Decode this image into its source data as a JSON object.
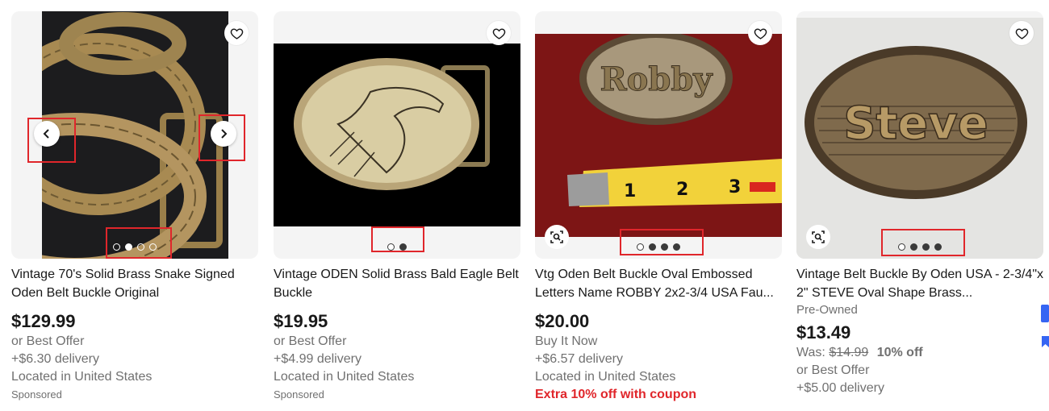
{
  "colors": {
    "accent_red": "#e0262b",
    "link_blue": "#3665f3",
    "muted_text": "#707070",
    "text": "#191919"
  },
  "icons": {
    "favorite": "heart-outline-icon",
    "prev": "chevron-left-icon",
    "next": "chevron-right-icon",
    "visual_search": "image-search-icon"
  },
  "listings": [
    {
      "title": "Vintage 70's Solid Brass Snake Signed Oden Belt Buckle Original",
      "price": "$129.99",
      "lines": [
        "or Best Offer",
        "+$6.30 delivery",
        "Located in United States"
      ],
      "footer": "Sponsored",
      "image_count": 4,
      "active_image": 2
    },
    {
      "title": "Vintage ODEN Solid Brass Bald Eagle Belt Buckle",
      "price": "$19.95",
      "lines": [
        "or Best Offer",
        "+$4.99 delivery",
        "Located in United States"
      ],
      "footer": "Sponsored",
      "image_count": 2,
      "active_image": 2
    },
    {
      "title": "Vtg Oden Belt Buckle Oval Embossed Letters Name ROBBY 2x2-3/4 USA Fau...",
      "price": "$20.00",
      "lines": [
        "Buy It Now",
        "+$6.57 delivery",
        "Located in United States"
      ],
      "promo": "Extra 10% off with coupon",
      "image_count": 4,
      "active_image": 1,
      "image_text": "Robby"
    },
    {
      "title": "Vintage Belt Buckle By Oden USA - 2-3/4\"x 2\" STEVE Oval Shape Brass...",
      "condition": "Pre-Owned",
      "price": "$13.49",
      "was_label": "Was:",
      "was_price": "$14.99",
      "discount": "10% off",
      "lines": [
        "or Best Offer",
        "+$5.00 delivery"
      ],
      "image_count": 4,
      "active_image": 1,
      "image_text": "Steve"
    }
  ]
}
